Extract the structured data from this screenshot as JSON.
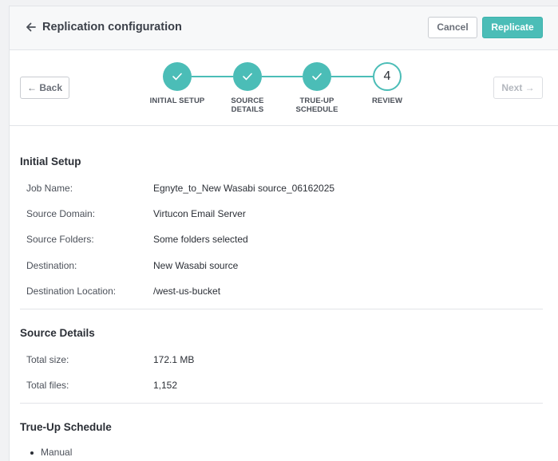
{
  "header": {
    "title": "Replication configuration",
    "cancel_label": "Cancel",
    "replicate_label": "Replicate"
  },
  "nav": {
    "back_label": "← Back",
    "next_label": "Next →"
  },
  "steps": [
    {
      "label": "INITIAL SETUP",
      "status": "complete",
      "icon": "check-icon"
    },
    {
      "label": "SOURCE\nDETAILS",
      "status": "complete",
      "icon": "check-icon"
    },
    {
      "label": "TRUE-UP\nSCHEDULE",
      "status": "complete",
      "icon": "check-icon"
    },
    {
      "label": "REVIEW",
      "status": "current",
      "number": "4"
    }
  ],
  "sections": {
    "initial_setup": {
      "title": "Initial Setup",
      "rows": [
        {
          "label": "Job Name:",
          "value": "Egnyte_to_New Wasabi source_06162025"
        },
        {
          "label": "Source Domain:",
          "value": "Virtucon Email Server"
        },
        {
          "label": "Source Folders:",
          "value": "Some folders selected"
        },
        {
          "label": "Destination:",
          "value": "New Wasabi source"
        },
        {
          "label": "Destination Location:",
          "value": "/west-us-bucket"
        }
      ]
    },
    "source_details": {
      "title": "Source Details",
      "rows": [
        {
          "label": "Total size:",
          "value": "172.1 MB"
        },
        {
          "label": "Total files:",
          "value": "1,152"
        }
      ]
    },
    "true_up_schedule": {
      "title": "True-Up Schedule",
      "items": [
        "Manual"
      ]
    }
  },
  "colors": {
    "accent": "#4bbdb7",
    "text": "#2b2f36",
    "muted": "#4b5059",
    "border": "#e2e4e8"
  }
}
